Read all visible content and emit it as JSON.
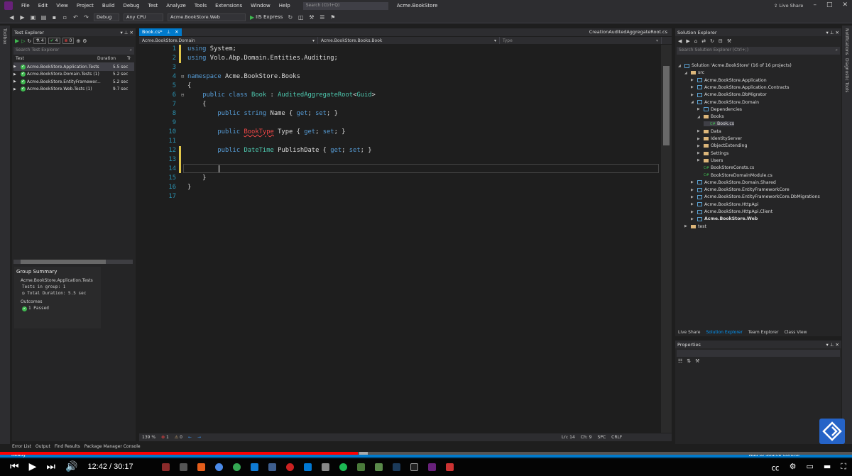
{
  "titlebar": {
    "menu": [
      "File",
      "Edit",
      "View",
      "Project",
      "Build",
      "Debug",
      "Test",
      "Analyze",
      "Tools",
      "Extensions",
      "Window",
      "Help"
    ],
    "search_placeholder": "Search (Ctrl+Q)",
    "app_title": "Acme.BookStore",
    "live_share": "Live Share"
  },
  "toolbar": {
    "config": "Debug",
    "platform": "Any CPU",
    "startup": "Acme.BookStore.Web",
    "run_label": "IIS Express"
  },
  "left_strip": [
    "Toolbox"
  ],
  "right_strip": [
    "Notifications",
    "Diagnostic Tools"
  ],
  "test_explorer": {
    "title": "Test Explorer",
    "counts": {
      "total": "4",
      "passed": "4",
      "failed": "0"
    },
    "search_placeholder": "Search Test Explorer",
    "columns": [
      "Test",
      "Duration",
      "Tr"
    ],
    "rows": [
      {
        "name": "Acme.BookStore.Application.Tests",
        "duration": "5.5 sec"
      },
      {
        "name": "Acme.BookStore.Domain.Tests (1)",
        "duration": "5.2 sec"
      },
      {
        "name": "Acme.BookStore.EntityFramewor...",
        "duration": "5.2 sec"
      },
      {
        "name": "Acme.BookStore.Web.Tests (1)",
        "duration": "9.7 sec"
      }
    ],
    "summary": {
      "title": "Group Summary",
      "group": "Acme.BookStore.Application.Tests",
      "tests_in_group": "Tests in group:  1",
      "total_duration": "Total Duration:  5.5 sec",
      "outcomes": "Outcomes",
      "passed": "1 Passed"
    }
  },
  "editor": {
    "tab": "Book.cs*",
    "tab_right": "CreationAuditedAggregateRoot.cs",
    "nav": [
      "Acme.BookStore.Domain",
      "Acme.BookStore.Books.Book",
      "Type"
    ],
    "lines": [
      "1",
      "2",
      "3",
      "4",
      "5",
      "6",
      "7",
      "8",
      "9",
      "10",
      "11",
      "12",
      "13",
      "14",
      "15",
      "16",
      "17"
    ],
    "zoom": "139 %",
    "errors": "1",
    "warnings": "0",
    "ln": "Ln: 14",
    "ch": "Ch: 9",
    "spc": "SPC",
    "crlf": "CRLF"
  },
  "solution_explorer": {
    "title": "Solution Explorer",
    "search_placeholder": "Search Solution Explorer (Ctrl+;)",
    "items": [
      {
        "label": "Solution 'Acme.BookStore' (16 of 16 projects)"
      },
      {
        "label": "src"
      },
      {
        "label": "Acme.BookStore.Application"
      },
      {
        "label": "Acme.BookStore.Application.Contracts"
      },
      {
        "label": "Acme.BookStore.DbMigrator"
      },
      {
        "label": "Acme.BookStore.Domain"
      },
      {
        "label": "Dependencies"
      },
      {
        "label": "Books"
      },
      {
        "label": "Book.cs"
      },
      {
        "label": "Data"
      },
      {
        "label": "IdentityServer"
      },
      {
        "label": "ObjectExtending"
      },
      {
        "label": "Settings"
      },
      {
        "label": "Users"
      },
      {
        "label": "BookStoreConsts.cs"
      },
      {
        "label": "BookStoreDomainModule.cs"
      },
      {
        "label": "Acme.BookStore.Domain.Shared"
      },
      {
        "label": "Acme.BookStore.EntityFrameworkCore"
      },
      {
        "label": "Acme.BookStore.EntityFrameworkCore.DbMigrations"
      },
      {
        "label": "Acme.BookStore.HttpApi"
      },
      {
        "label": "Acme.BookStore.HttpApi.Client"
      },
      {
        "label": "Acme.BookStore.Web"
      },
      {
        "label": "test"
      }
    ],
    "tabs": [
      "Live Share",
      "Solution Explorer",
      "Team Explorer",
      "Class View"
    ]
  },
  "properties": {
    "title": "Properties"
  },
  "bottom_tabs": [
    "Error List",
    "Output",
    "Find Results",
    "Package Manager Console"
  ],
  "status": {
    "ready": "Ready"
  },
  "player": {
    "time": "12:42 / 30:17",
    "progress_fraction": 0.42,
    "add_source": "Add to Source Control"
  },
  "colors": {
    "accent": "#007acc",
    "pass": "#3fb950",
    "progress": "#ff0000"
  }
}
